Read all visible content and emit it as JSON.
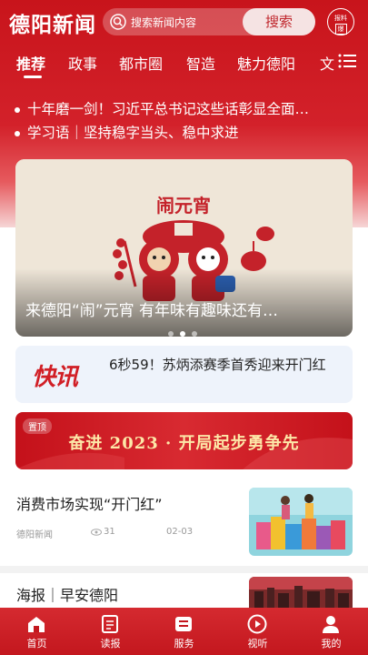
{
  "header": {
    "app_title": "德阳新闻",
    "search_placeholder": "搜索新闻内容",
    "search_button": "搜索",
    "report_label": "报料",
    "report_box": "爆"
  },
  "tabs": [
    {
      "label": "推荐",
      "active": true
    },
    {
      "label": "政事",
      "active": false
    },
    {
      "label": "都市圈",
      "active": false
    },
    {
      "label": "智造",
      "active": false
    },
    {
      "label": "魅力德阳",
      "active": false
    },
    {
      "label": "文",
      "active": false
    }
  ],
  "headlines": [
    "十年磨一剑！习近平总书记这些话彰显全面…",
    "学习语｜坚持稳字当头、稳中求进"
  ],
  "carousel": {
    "art_title": "闹元宵",
    "caption": "来德阳“闹”元宵 有年味有趣味还有…",
    "slide_count": 3,
    "active_slide": 2
  },
  "flash_news": {
    "logo": "快讯",
    "text": "6秒59！苏炳添赛季首秀迎来开门红"
  },
  "banner": {
    "tag": "置顶",
    "text": "奋进 2023 · 开局起步勇争先"
  },
  "news": [
    {
      "title": "消费市场实现“开门红”",
      "source": "德阳新闻",
      "views": "31",
      "date": "02-03"
    },
    {
      "title": "海报｜早安德阳"
    }
  ],
  "bottom_nav": [
    {
      "label": "首页",
      "icon": "home-icon"
    },
    {
      "label": "读报",
      "icon": "newspaper-icon"
    },
    {
      "label": "服务",
      "icon": "service-icon"
    },
    {
      "label": "视听",
      "icon": "play-icon"
    },
    {
      "label": "我的",
      "icon": "user-icon"
    }
  ],
  "colors": {
    "brand_red": "#c8141b",
    "banner_gold": "#fde7a8",
    "flash_bg": "#eef3fb"
  }
}
